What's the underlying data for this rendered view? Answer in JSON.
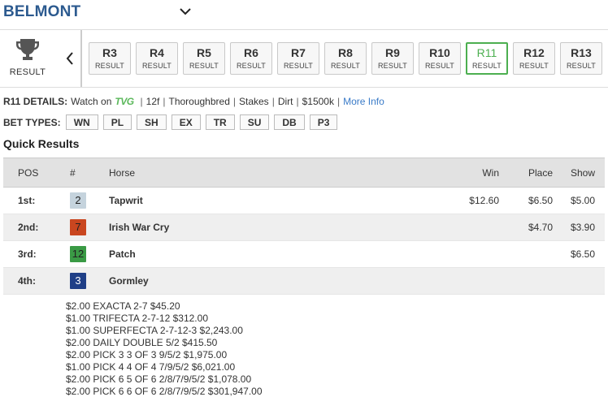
{
  "track": {
    "name": "BELMONT"
  },
  "race_bar": {
    "result_label": "RESULT",
    "races": [
      {
        "num": "R3",
        "sub": "RESULT",
        "active": false
      },
      {
        "num": "R4",
        "sub": "RESULT",
        "active": false
      },
      {
        "num": "R5",
        "sub": "RESULT",
        "active": false
      },
      {
        "num": "R6",
        "sub": "RESULT",
        "active": false
      },
      {
        "num": "R7",
        "sub": "RESULT",
        "active": false
      },
      {
        "num": "R8",
        "sub": "RESULT",
        "active": false
      },
      {
        "num": "R9",
        "sub": "RESULT",
        "active": false
      },
      {
        "num": "R10",
        "sub": "RESULT",
        "active": false
      },
      {
        "num": "R11",
        "sub": "RESULT",
        "active": true
      },
      {
        "num": "R12",
        "sub": "RESULT",
        "active": false
      },
      {
        "num": "R13",
        "sub": "RESULT",
        "active": false
      }
    ],
    "active_color": "#4caf50"
  },
  "details": {
    "label": "R11 DETAILS:",
    "watch_on": "Watch on",
    "tvg": "TVG",
    "distance": "12f",
    "breed": "Thoroughbred",
    "race_type": "Stakes",
    "surface": "Dirt",
    "purse": "$1500k",
    "more_info": "More Info"
  },
  "bet_types": {
    "label": "BET TYPES:",
    "items": [
      "WN",
      "PL",
      "SH",
      "EX",
      "TR",
      "SU",
      "DB",
      "P3"
    ]
  },
  "quick_results": {
    "title": "Quick Results",
    "columns": {
      "pos": "POS",
      "num": "#",
      "horse": "Horse",
      "win": "Win",
      "place": "Place",
      "show": "Show"
    },
    "rows": [
      {
        "pos": "1st:",
        "num": "2",
        "badge_bg": "#c5d3dd",
        "badge_fg": "#222",
        "horse": "Tapwrit",
        "win": "$12.60",
        "place": "$6.50",
        "show": "$5.00"
      },
      {
        "pos": "2nd:",
        "num": "7",
        "badge_bg": "#c9461f",
        "badge_fg": "#222",
        "horse": "Irish War Cry",
        "win": "",
        "place": "$4.70",
        "show": "$3.90"
      },
      {
        "pos": "3rd:",
        "num": "12",
        "badge_bg": "#3a9a45",
        "badge_fg": "#222",
        "horse": "Patch",
        "win": "",
        "place": "",
        "show": "$6.50"
      },
      {
        "pos": "4th:",
        "num": "3",
        "badge_bg": "#1f3f87",
        "badge_fg": "#ffffff",
        "horse": "Gormley",
        "win": "",
        "place": "",
        "show": ""
      }
    ]
  },
  "payouts": [
    "$2.00 EXACTA 2-7 $45.20",
    "$1.00 TRIFECTA 2-7-12 $312.00",
    "$1.00 SUPERFECTA 2-7-12-3 $2,243.00",
    "$2.00 DAILY DOUBLE 5/2 $415.50",
    "$2.00 PICK 3 3 OF 3 9/5/2 $1,975.00",
    "$1.00 PICK 4 4 OF 4 7/9/5/2 $6,021.00",
    "$2.00 PICK 6 5 OF 6 2/8/7/9/5/2 $1,078.00",
    "$2.00 PICK 6 6 OF 6 2/8/7/9/5/2 $301,947.00"
  ],
  "icons": {
    "trophy": "trophy-icon",
    "chevron_down": "chevron-down-icon",
    "chevron_left": "chevron-left-icon"
  }
}
